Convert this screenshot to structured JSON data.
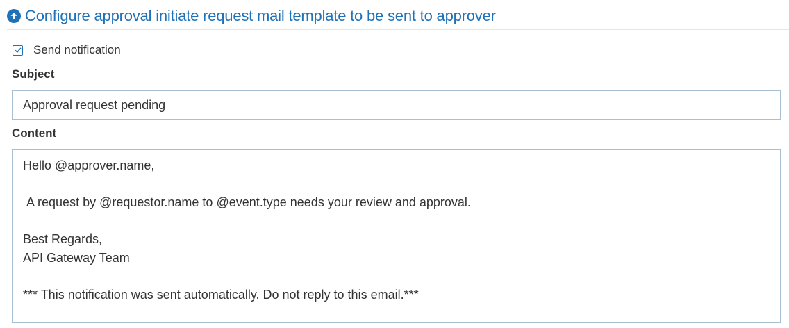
{
  "section": {
    "title": "Configure approval initiate request mail template to be sent to approver",
    "collapse_icon": "arrow-up-circle-icon",
    "accent_color": "#1f72b8"
  },
  "notification": {
    "label": "Send notification",
    "checked": true
  },
  "subject": {
    "label": "Subject",
    "value": "Approval request pending"
  },
  "content": {
    "label": "Content",
    "value": "Hello @approver.name,\n\n A request by @requestor.name to @event.type needs your review and approval.\n\nBest Regards,\nAPI Gateway Team\n\n*** This notification was sent automatically. Do not reply to this email.***"
  }
}
